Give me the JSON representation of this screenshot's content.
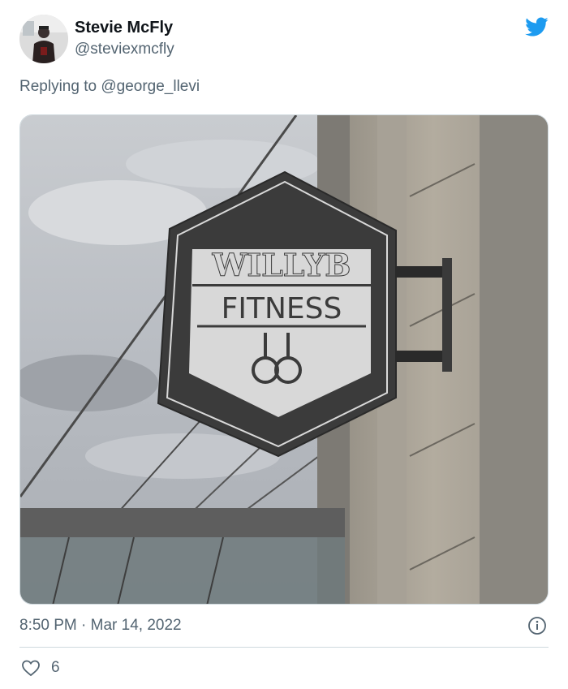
{
  "user": {
    "name": "Stevie McFly",
    "handle": "@steviexmcfly"
  },
  "reply": {
    "text": "Replying to @george_llevi"
  },
  "photo": {
    "sign_line1": "WILLYB",
    "sign_line2": "FITNESS"
  },
  "meta": {
    "timestamp": "8:50 PM · Mar 14, 2022",
    "likes": "6"
  },
  "colors": {
    "twitter_blue": "#1d9bf0",
    "secondary_text": "#536471",
    "divider": "#cfd9de"
  },
  "icons": [
    "twitter-bird-icon",
    "info-icon",
    "heart-icon"
  ]
}
